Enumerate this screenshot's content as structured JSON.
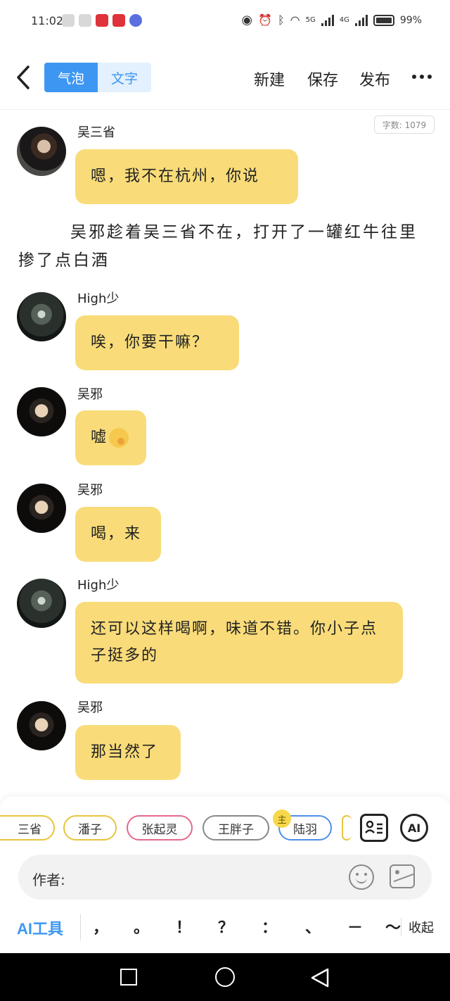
{
  "status_bar": {
    "time": "11:02",
    "battery": "99%",
    "net_5g": "5G",
    "net_4g": "4G"
  },
  "header": {
    "tab_bubble": "气泡",
    "tab_text": "文字",
    "new_label": "新建",
    "save_label": "保存",
    "publish_label": "发布"
  },
  "word_count": "字数: 1079",
  "messages": [
    {
      "speaker": "吴三省",
      "text": "嗯，我不在杭州，你说"
    },
    {
      "speaker": "High少",
      "text": "唉，你要干嘛？"
    },
    {
      "speaker": "吴邪",
      "text": "嘘"
    },
    {
      "speaker": "吴邪",
      "text": "喝，来"
    },
    {
      "speaker": "High少",
      "text": "还可以这样喝啊，味道不错。你小子点子挺多的"
    },
    {
      "speaker": "吴邪",
      "text": "那当然了"
    }
  ],
  "narration": "吴邪趁着吴三省不在，打开了一罐红牛往里掺了点白酒",
  "characters": [
    {
      "name": "三省",
      "color": "#e8c43c"
    },
    {
      "name": "潘子",
      "color": "#e8c43c"
    },
    {
      "name": "张起灵",
      "color": "#e26a8a"
    },
    {
      "name": "王胖子",
      "color": "#888888"
    },
    {
      "name": "陆羽",
      "color": "#4f8fe8"
    }
  ],
  "main_badge": "主",
  "ai_button": "AI",
  "author_label": "作者:",
  "ai_tools": "AI工具",
  "punctuation": [
    "，",
    "。",
    "！",
    "？",
    "：",
    "、",
    "－",
    "～"
  ],
  "collapse": "收起"
}
